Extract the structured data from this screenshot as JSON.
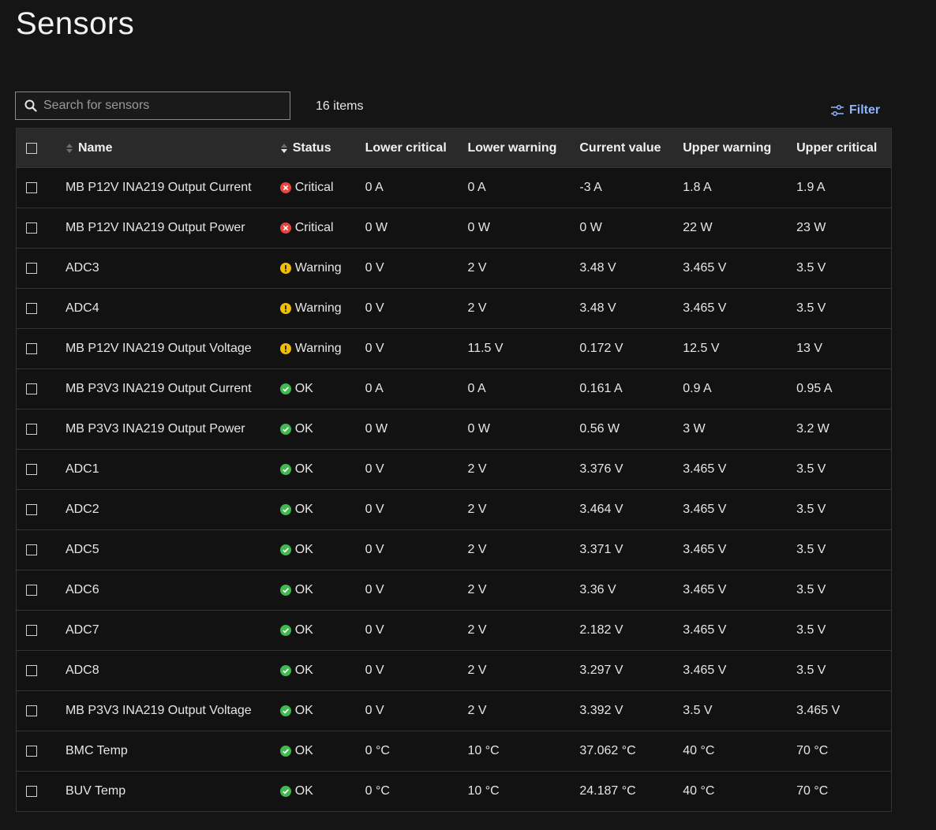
{
  "page": {
    "title": "Sensors"
  },
  "search": {
    "placeholder": "Search for sensors"
  },
  "item_count": "16 items",
  "filter": {
    "label": "Filter"
  },
  "colors": {
    "accent": "#8fb4ff",
    "critical": "#e8453c",
    "warning": "#f0c000",
    "ok": "#3fb950"
  },
  "table": {
    "headers": {
      "name": "Name",
      "status": "Status",
      "lower_critical": "Lower critical",
      "lower_warning": "Lower warning",
      "current_value": "Current value",
      "upper_warning": "Upper warning",
      "upper_critical": "Upper critical"
    },
    "rows": [
      {
        "name": "MB P12V INA219 Output Current",
        "status": "Critical",
        "status_icon": "critical-icon",
        "lc": "0 A",
        "lw": "0 A",
        "cv": "-3 A",
        "uw": "1.8 A",
        "uc": "1.9 A"
      },
      {
        "name": "MB P12V INA219 Output Power",
        "status": "Critical",
        "status_icon": "critical-icon",
        "lc": "0 W",
        "lw": "0 W",
        "cv": "0 W",
        "uw": "22 W",
        "uc": "23 W"
      },
      {
        "name": "ADC3",
        "status": "Warning",
        "status_icon": "warning-icon",
        "lc": "0 V",
        "lw": "2 V",
        "cv": "3.48 V",
        "uw": "3.465 V",
        "uc": "3.5 V"
      },
      {
        "name": "ADC4",
        "status": "Warning",
        "status_icon": "warning-icon",
        "lc": "0 V",
        "lw": "2 V",
        "cv": "3.48 V",
        "uw": "3.465 V",
        "uc": "3.5 V"
      },
      {
        "name": "MB P12V INA219 Output Voltage",
        "status": "Warning",
        "status_icon": "warning-icon",
        "lc": "0 V",
        "lw": "11.5 V",
        "cv": "0.172 V",
        "uw": "12.5 V",
        "uc": "13 V"
      },
      {
        "name": "MB P3V3 INA219 Output Current",
        "status": "OK",
        "status_icon": "ok-icon",
        "lc": "0 A",
        "lw": "0 A",
        "cv": "0.161 A",
        "uw": "0.9 A",
        "uc": "0.95 A"
      },
      {
        "name": "MB P3V3 INA219 Output Power",
        "status": "OK",
        "status_icon": "ok-icon",
        "lc": "0 W",
        "lw": "0 W",
        "cv": "0.56 W",
        "uw": "3 W",
        "uc": "3.2 W"
      },
      {
        "name": "ADC1",
        "status": "OK",
        "status_icon": "ok-icon",
        "lc": "0 V",
        "lw": "2 V",
        "cv": "3.376 V",
        "uw": "3.465 V",
        "uc": "3.5 V"
      },
      {
        "name": "ADC2",
        "status": "OK",
        "status_icon": "ok-icon",
        "lc": "0 V",
        "lw": "2 V",
        "cv": "3.464 V",
        "uw": "3.465 V",
        "uc": "3.5 V"
      },
      {
        "name": "ADC5",
        "status": "OK",
        "status_icon": "ok-icon",
        "lc": "0 V",
        "lw": "2 V",
        "cv": "3.371 V",
        "uw": "3.465 V",
        "uc": "3.5 V"
      },
      {
        "name": "ADC6",
        "status": "OK",
        "status_icon": "ok-icon",
        "lc": "0 V",
        "lw": "2 V",
        "cv": "3.36 V",
        "uw": "3.465 V",
        "uc": "3.5 V"
      },
      {
        "name": "ADC7",
        "status": "OK",
        "status_icon": "ok-icon",
        "lc": "0 V",
        "lw": "2 V",
        "cv": "2.182 V",
        "uw": "3.465 V",
        "uc": "3.5 V"
      },
      {
        "name": "ADC8",
        "status": "OK",
        "status_icon": "ok-icon",
        "lc": "0 V",
        "lw": "2 V",
        "cv": "3.297 V",
        "uw": "3.465 V",
        "uc": "3.5 V"
      },
      {
        "name": "MB P3V3 INA219 Output Voltage",
        "status": "OK",
        "status_icon": "ok-icon",
        "lc": "0 V",
        "lw": "2 V",
        "cv": "3.392 V",
        "uw": "3.5 V",
        "uc": "3.465 V"
      },
      {
        "name": "BMC Temp",
        "status": "OK",
        "status_icon": "ok-icon",
        "lc": "0 °C",
        "lw": "10 °C",
        "cv": "37.062 °C",
        "uw": "40 °C",
        "uc": "70 °C"
      },
      {
        "name": "BUV Temp",
        "status": "OK",
        "status_icon": "ok-icon",
        "lc": "0 °C",
        "lw": "10 °C",
        "cv": "24.187 °C",
        "uw": "40 °C",
        "uc": "70 °C"
      }
    ]
  }
}
